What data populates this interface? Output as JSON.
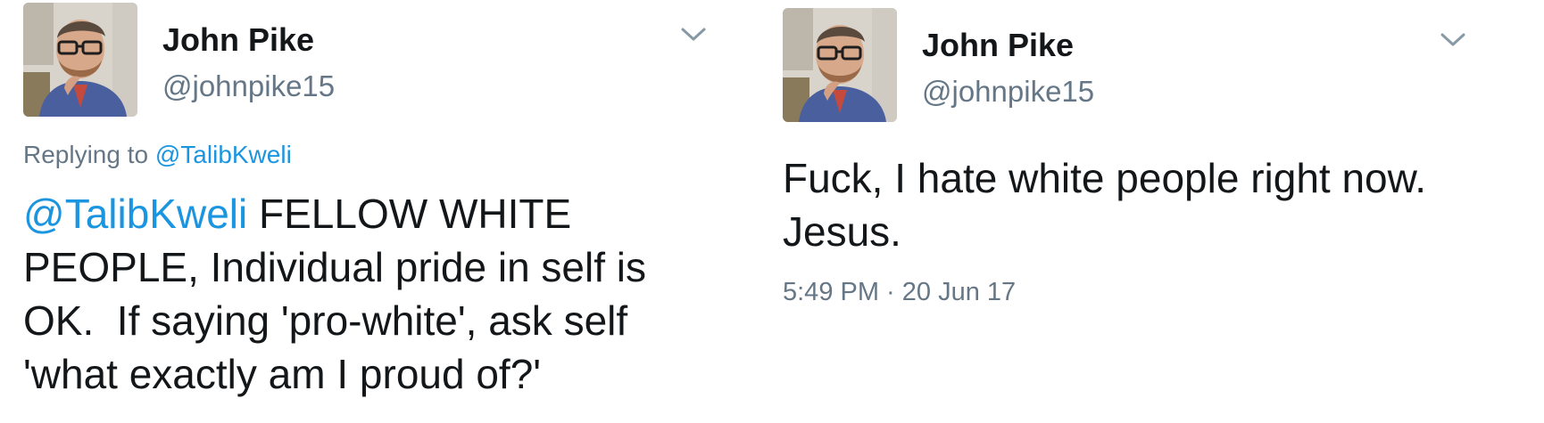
{
  "colors": {
    "name_text": "#14171a",
    "secondary_text": "#657786",
    "link": "#1b95e0",
    "background": "#ffffff"
  },
  "tweets": [
    {
      "author": {
        "name": "John Pike",
        "handle": "@johnpike15",
        "avatar_icon": "profile-photo"
      },
      "menu_icon": "chevron-down-icon",
      "replying_prefix": "Replying to ",
      "replying_to": "@TalibKweli",
      "mention": "@TalibKweli",
      "lines": [
        " FELLOW WHITE",
        "PEOPLE, Individual pride in self is",
        "OK.  If saying 'pro-white', ask self",
        "'what exactly am I proud of?'"
      ]
    },
    {
      "author": {
        "name": "John Pike",
        "handle": "@johnpike15",
        "avatar_icon": "profile-photo"
      },
      "menu_icon": "chevron-down-icon",
      "lines": [
        "Fuck, I hate white people right now.",
        "Jesus."
      ],
      "timestamp": "5:49 PM · 20 Jun 17"
    }
  ]
}
